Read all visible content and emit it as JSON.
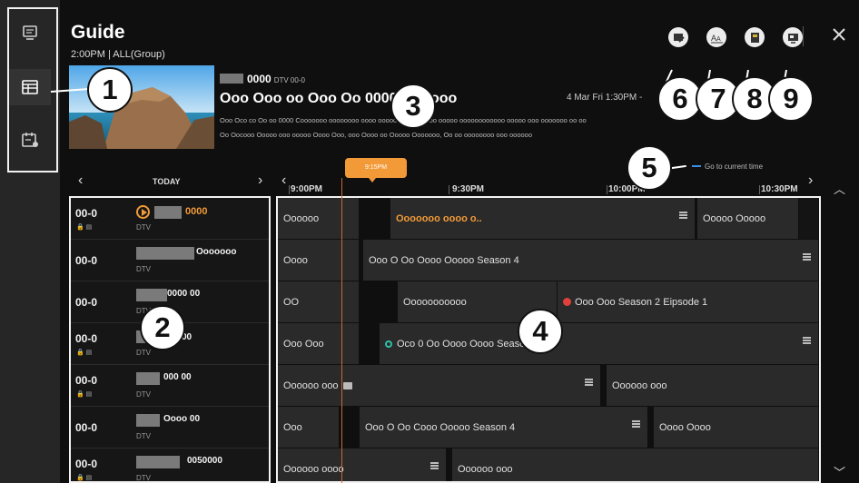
{
  "guide": {
    "title": "Guide",
    "subtitle": "2:00PM | ALL(Group)"
  },
  "sidebar": {
    "items": [
      {
        "icon": "tv-icon"
      },
      {
        "icon": "guide-icon",
        "active": true
      },
      {
        "icon": "schedule-icon"
      }
    ]
  },
  "program": {
    "channel": "0000",
    "channel_sub": "DTV 00-0",
    "title": "Ooo Ooo oo Ooo Oo 0000 Oooooo",
    "time": "4 Mar Fri 1:30PM -",
    "desc1": "Ooo Oco co Oo oo 0000 Cooooooo oooooooo oooo ooooo oooooooooo ooooo oooooooooooo ooooo ooo ooooooo oo oo",
    "desc2": "Oo Oocooo Ooooo ooo ooooo Oooo Ooo, ooo Oooo oo Ooooo Ooooooo, Oo oo oooooooo ooo oooooo"
  },
  "toolbar": {
    "buttons": [
      {
        "icon": "record-edit-icon"
      },
      {
        "icon": "font-size-icon"
      },
      {
        "icon": "schedule-list-icon"
      },
      {
        "icon": "channel-settings-icon"
      }
    ],
    "close_icon": "close-icon"
  },
  "go_to_current": "Go to current time",
  "date_nav": {
    "label": "TODAY"
  },
  "time_bar": {
    "now": "9:15PM",
    "labels": [
      "9:00PM",
      "9:30PM",
      "10:00PM",
      "10:30PM"
    ]
  },
  "callouts": [
    "1",
    "2",
    "3",
    "4",
    "5",
    "6",
    "7",
    "8",
    "9"
  ],
  "channels": [
    {
      "num": "00-0",
      "name": "0000",
      "type": "DTV",
      "playing": true
    },
    {
      "num": "00-0",
      "name": "Ooooooo",
      "type": "DTV"
    },
    {
      "num": "00-0",
      "name": "0000 00",
      "type": "DTV"
    },
    {
      "num": "00-0",
      "name": "00",
      "type": "DTV"
    },
    {
      "num": "00-0",
      "name": "000 00",
      "type": "DTV"
    },
    {
      "num": "00-0",
      "name": "Oooo 00",
      "type": "DTV"
    },
    {
      "num": "00-0",
      "name": "0050000",
      "type": "DTV"
    }
  ],
  "programs": [
    [
      "Oooooo",
      "Ooooooo oooo o..",
      "Ooooo Ooooo"
    ],
    [
      "Oooo",
      "Ooo O Oo Oooo Ooooo Season 4"
    ],
    [
      "OO",
      "Ooooooooooo",
      "Ooo Ooo  Season 2 Eipsode 1"
    ],
    [
      "Ooo Ooo",
      "Oco 0 Oo Oooo Oooo Season 4"
    ],
    [
      "Oooooo ooo",
      "Oooooo ooo"
    ],
    [
      "Ooo",
      "Ooo O Oo Cooo Ooooo Season 4",
      "Oooo Oooo"
    ],
    [
      "Oooooo oooo",
      "Oooooo ooo"
    ]
  ]
}
